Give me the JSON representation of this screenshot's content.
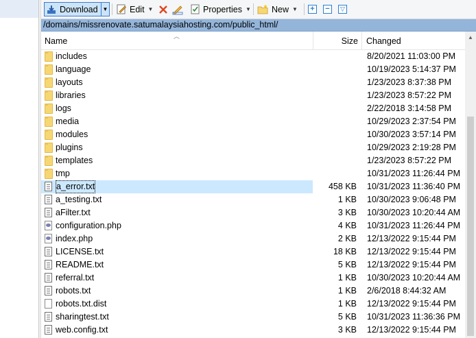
{
  "toolbar": {
    "download_label": "Download",
    "edit_label": "Edit",
    "properties_label": "Properties",
    "new_label": "New"
  },
  "path": "/domains/missrenovate.satumalaysiahosting.com/public_html/",
  "columns": {
    "name": "Name",
    "size": "Size",
    "changed": "Changed"
  },
  "files": [
    {
      "name": "includes",
      "type": "folder",
      "size": "",
      "changed": "8/20/2021 11:03:00 PM"
    },
    {
      "name": "language",
      "type": "folder",
      "size": "",
      "changed": "10/19/2023 5:14:37 PM"
    },
    {
      "name": "layouts",
      "type": "folder",
      "size": "",
      "changed": "1/23/2023 8:37:38 PM"
    },
    {
      "name": "libraries",
      "type": "folder",
      "size": "",
      "changed": "1/23/2023 8:57:22 PM"
    },
    {
      "name": "logs",
      "type": "folder",
      "size": "",
      "changed": "2/22/2018 3:14:58 PM"
    },
    {
      "name": "media",
      "type": "folder",
      "size": "",
      "changed": "10/29/2023 2:37:54 PM"
    },
    {
      "name": "modules",
      "type": "folder",
      "size": "",
      "changed": "10/30/2023 3:57:14 PM"
    },
    {
      "name": "plugins",
      "type": "folder",
      "size": "",
      "changed": "10/29/2023 2:19:28 PM"
    },
    {
      "name": "templates",
      "type": "folder",
      "size": "",
      "changed": "1/23/2023 8:57:22 PM"
    },
    {
      "name": "tmp",
      "type": "folder",
      "size": "",
      "changed": "10/31/2023 11:26:44 PM"
    },
    {
      "name": "a_error.txt",
      "type": "txt",
      "size": "458 KB",
      "changed": "10/31/2023 11:36:40 PM",
      "selected": true
    },
    {
      "name": "a_testing.txt",
      "type": "txt",
      "size": "1 KB",
      "changed": "10/30/2023 9:06:48 PM"
    },
    {
      "name": "aFilter.txt",
      "type": "txt",
      "size": "3 KB",
      "changed": "10/30/2023 10:20:44 AM"
    },
    {
      "name": "configuration.php",
      "type": "php",
      "size": "4 KB",
      "changed": "10/31/2023 11:26:44 PM"
    },
    {
      "name": "index.php",
      "type": "php",
      "size": "2 KB",
      "changed": "12/13/2022 9:15:44 PM"
    },
    {
      "name": "LICENSE.txt",
      "type": "txt",
      "size": "18 KB",
      "changed": "12/13/2022 9:15:44 PM"
    },
    {
      "name": "README.txt",
      "type": "txt",
      "size": "5 KB",
      "changed": "12/13/2022 9:15:44 PM"
    },
    {
      "name": "referral.txt",
      "type": "txt",
      "size": "1 KB",
      "changed": "10/30/2023 10:20:44 AM"
    },
    {
      "name": "robots.txt",
      "type": "txt",
      "size": "1 KB",
      "changed": "2/6/2018 8:44:32 AM"
    },
    {
      "name": "robots.txt.dist",
      "type": "blank",
      "size": "1 KB",
      "changed": "12/13/2022 9:15:44 PM"
    },
    {
      "name": "sharingtest.txt",
      "type": "txt",
      "size": "5 KB",
      "changed": "10/31/2023 11:36:36 PM"
    },
    {
      "name": "web.config.txt",
      "type": "txt",
      "size": "3 KB",
      "changed": "12/13/2022 9:15:44 PM"
    }
  ]
}
